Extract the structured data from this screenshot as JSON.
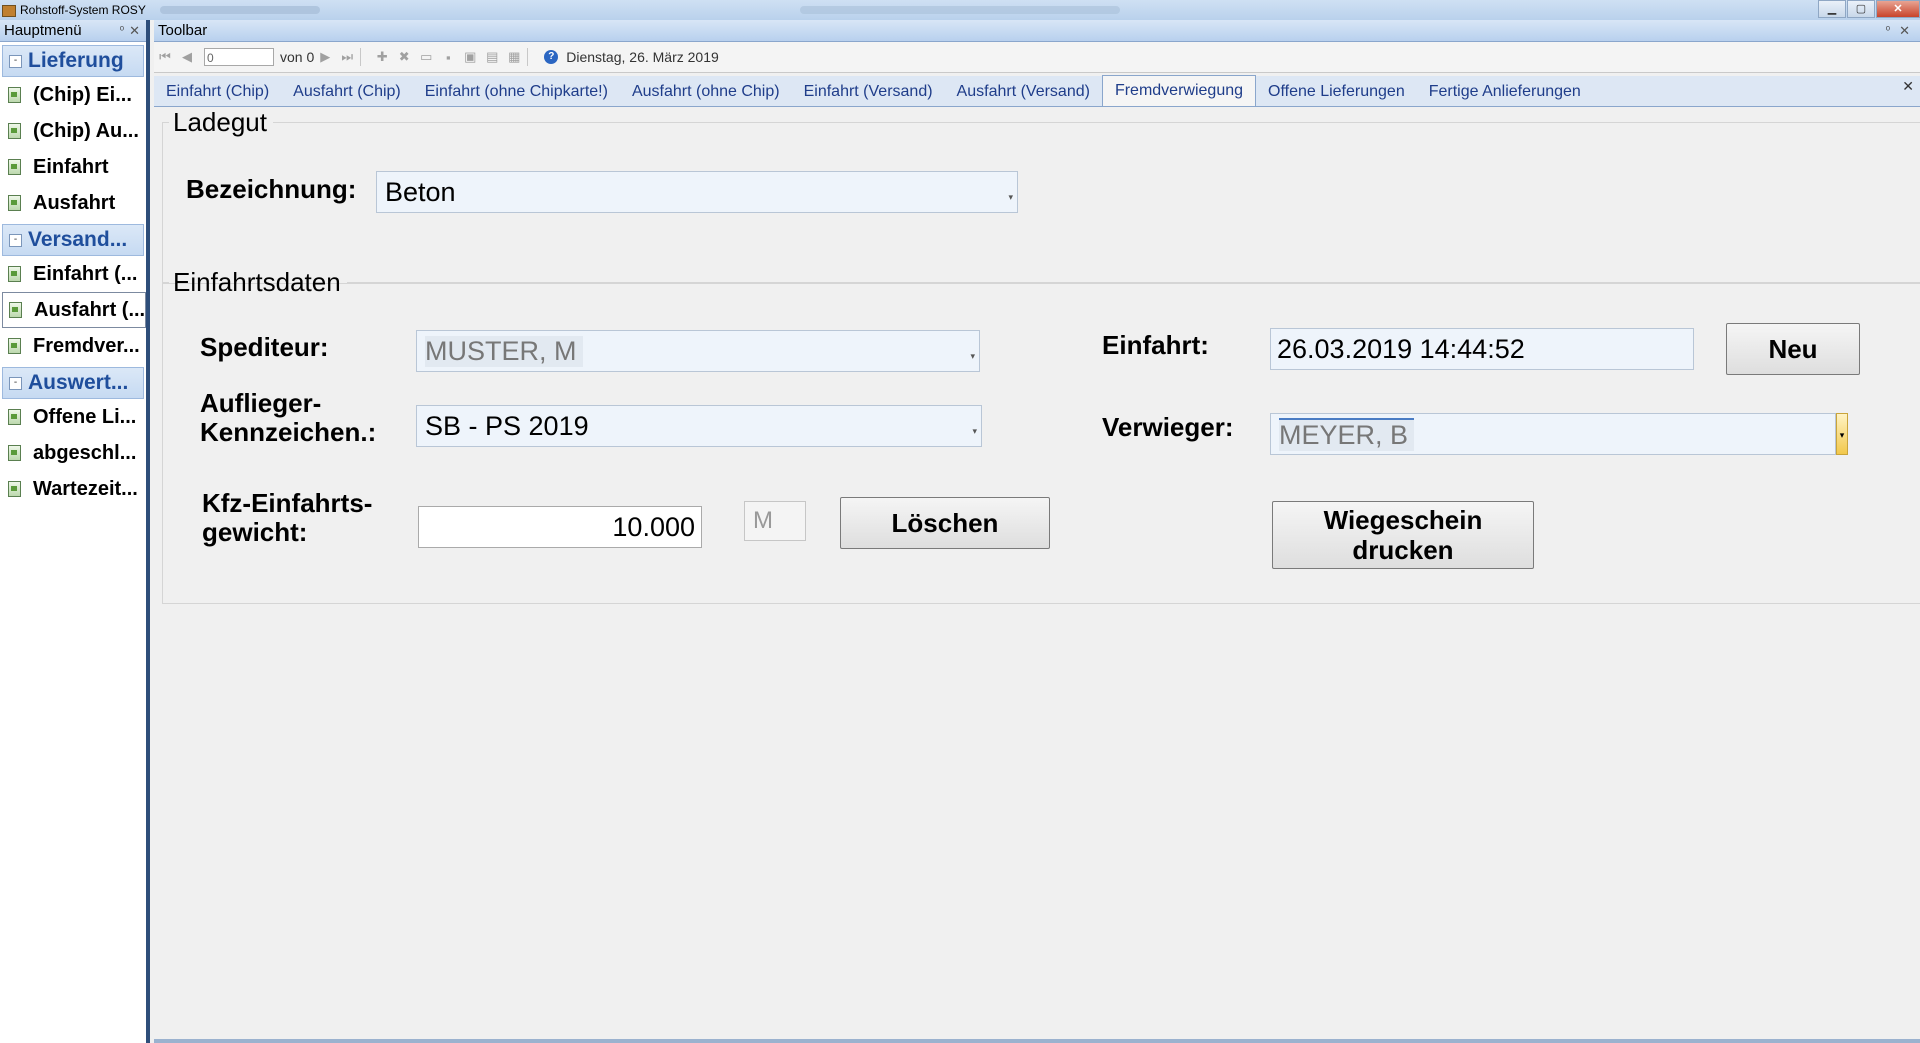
{
  "window": {
    "title": "Rohstoff-System ROSY",
    "buttons": {
      "minimize": "▁",
      "maximize": "▢",
      "close": "✕"
    }
  },
  "sidebar": {
    "header": "Hauptmenü",
    "pin": "ᵒ",
    "close": "✕",
    "groups": [
      {
        "label": "Lieferung",
        "items": [
          "(Chip) Ei...",
          "(Chip) Au...",
          "Einfahrt",
          "Ausfahrt"
        ]
      },
      {
        "label": "Versand...",
        "items": [
          "Einfahrt (...",
          "Ausfahrt (...",
          "Fremdver..."
        ]
      },
      {
        "label": "Auswert...",
        "items": [
          "Offene Li...",
          "abgeschl...",
          "Wartezeit..."
        ]
      }
    ],
    "expanded_marker": "-"
  },
  "toolbar": {
    "header": "Toolbar",
    "pin": "ᵒ",
    "close": "✕",
    "position_value": "0",
    "of_label": "von 0",
    "date": "Dienstag, 26. März 2019",
    "icons": [
      "first-icon",
      "prev-icon",
      "next-icon",
      "last-icon",
      "add-icon",
      "delete-icon",
      "open-icon",
      "save-icon",
      "save-all-icon",
      "print-icon",
      "preview-icon",
      "info-icon"
    ]
  },
  "tabs": [
    "Einfahrt (Chip)",
    "Ausfahrt (Chip)",
    "Einfahrt (ohne Chipkarte!)",
    "Ausfahrt (ohne Chip)",
    "Einfahrt (Versand)",
    "Ausfahrt (Versand)",
    "Fremdverwiegung",
    "Offene Lieferungen",
    "Fertige Anlieferungen"
  ],
  "active_tab": "Fremdverwiegung",
  "tab_close": "✕",
  "ladegut": {
    "title": "Ladegut",
    "bezeichnung_label": "Bezeichnung:",
    "bezeichnung_value": "Beton"
  },
  "einfahrtsdaten": {
    "title": "Einfahrtsdaten",
    "spediteur_label": "Spediteur:",
    "spediteur_value": "MUSTER, M",
    "auflieger_label_1": "Auflieger-",
    "auflieger_label_2": "Kennzeichen.:",
    "auflieger_value": "SB - PS 2019",
    "gewicht_label_1": "Kfz-Einfahrts-",
    "gewicht_label_2": "gewicht:",
    "gewicht_value": "10.000",
    "unit_value": "M",
    "loeschen_label": "Löschen",
    "einfahrt_label": "Einfahrt:",
    "einfahrt_value": "26.03.2019 14:44:52",
    "neu_label": "Neu",
    "verwieger_label": "Verwieger:",
    "verwieger_value": "MEYER, B",
    "wiegeschein_label_1": "Wiegeschein",
    "wiegeschein_label_2": "drucken"
  },
  "colors": {
    "accent": "#1f4e9c",
    "panel_header": "#c6daf2",
    "sidebar_border": "#2e4e7a"
  }
}
